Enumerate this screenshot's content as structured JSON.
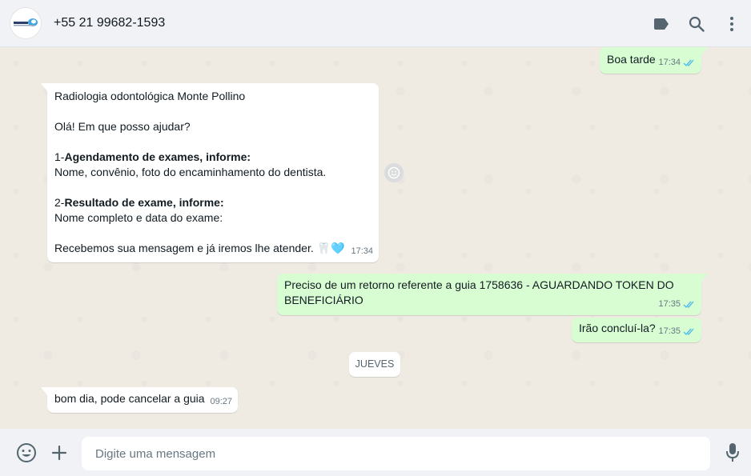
{
  "header": {
    "contact_name": "+55 21 99682-1593",
    "icons": [
      "label-icon",
      "search-icon",
      "menu-icon"
    ]
  },
  "messages": [
    {
      "direction": "out",
      "text": "Boa tarde",
      "time": "17:34",
      "status": "read"
    },
    {
      "direction": "in",
      "lines": [
        {
          "plain": "Radiologia odontológica Monte Pollino"
        },
        {
          "plain": ""
        },
        {
          "plain": "Olá! Em que posso ajudar?"
        },
        {
          "plain": ""
        },
        {
          "prefix": "1-",
          "bold": "Agendamento de exames, informe:"
        },
        {
          "plain": "Nome, convênio, foto do encaminhamento do dentista."
        },
        {
          "plain": ""
        },
        {
          "prefix": "2-",
          "bold": "Resultado de exame, informe:"
        },
        {
          "plain": "Nome completo e data do exame:"
        },
        {
          "plain": ""
        },
        {
          "plain": "Recebemos sua mensagem e já iremos lhe atender. 🦷🩵"
        }
      ],
      "time": "17:34"
    },
    {
      "direction": "out",
      "text": "Preciso de um retorno referente  a guia 1758636 - AGUARDANDO TOKEN DO BENEFICIÁRIO",
      "time": "17:35",
      "status": "read"
    },
    {
      "direction": "out",
      "text": "Irão concluí-la?",
      "time": "17:35",
      "status": "read"
    },
    {
      "direction": "in",
      "text": "bom dia, pode cancelar a guia",
      "time": "09:27"
    }
  ],
  "day_separator": "JUEVES",
  "composer": {
    "placeholder": "Digite uma mensagem",
    "icons": [
      "emoji-icon",
      "attach-plus-icon",
      "microphone-icon"
    ]
  },
  "colors": {
    "outgoing_bubble": "#d9fdd3",
    "incoming_bubble": "#ffffff",
    "read_ticks": "#53bdeb",
    "chat_background": "#efeae2"
  }
}
